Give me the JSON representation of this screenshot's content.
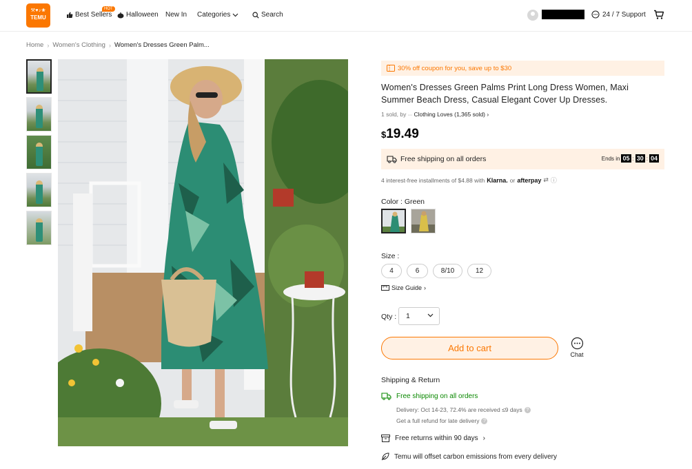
{
  "header": {
    "logo_line1": "⚒♥♪❀",
    "logo_line2": "TEMU",
    "nav": {
      "best_sellers": "Best Sellers",
      "hot_badge": "HOT",
      "halloween": "Halloween",
      "new_in": "New In",
      "categories": "Categories",
      "search": "Search"
    },
    "support": "24 / 7 Support"
  },
  "breadcrumb": {
    "home": "Home",
    "category": "Women's Clothing",
    "current": "Women's Dresses Green Palm..."
  },
  "product": {
    "coupon": "30% off coupon for you, save up to $30",
    "title": "Women's Dresses Green Palms Print Long Dress Women, Maxi Summer Beach Dress, Casual Elegant Cover Up Dresses.",
    "sold_prefix": "1 sold, by",
    "store": "Clothing Loves (1,365 sold)",
    "store_chevron": "›",
    "price_currency": "$",
    "price_amount": "19.49",
    "free_shipping": "Free shipping on all orders",
    "ends_label": "Ends in",
    "timer": {
      "h": "05",
      "m": "30",
      "s": "04"
    },
    "installments_prefix": "4 interest-free installments of $4.88 with",
    "klarna": "Klarna.",
    "or_text": "or",
    "afterpay": "afterpay",
    "color_label": "Color : Green",
    "size_label": "Size :",
    "sizes": [
      "4",
      "6",
      "8/10",
      "12"
    ],
    "size_guide": "Size Guide",
    "qty_label": "Qty :",
    "qty_value": "1",
    "add_to_cart": "Add to cart",
    "chat": "Chat"
  },
  "shipping_return": {
    "title": "Shipping & Return",
    "free_shipping": "Free shipping on all orders",
    "delivery": "Delivery: Oct 14-23, 72.4% are received ≤9 days",
    "refund": "Get a full refund for late delivery",
    "returns": "Free returns within 90 days",
    "returns_chevron": "›",
    "carbon": "Temu will offset carbon emissions from every delivery"
  },
  "colors": {
    "accent": "#fb7701",
    "accent_bg": "#fff1e4",
    "green": "#0a8800"
  }
}
